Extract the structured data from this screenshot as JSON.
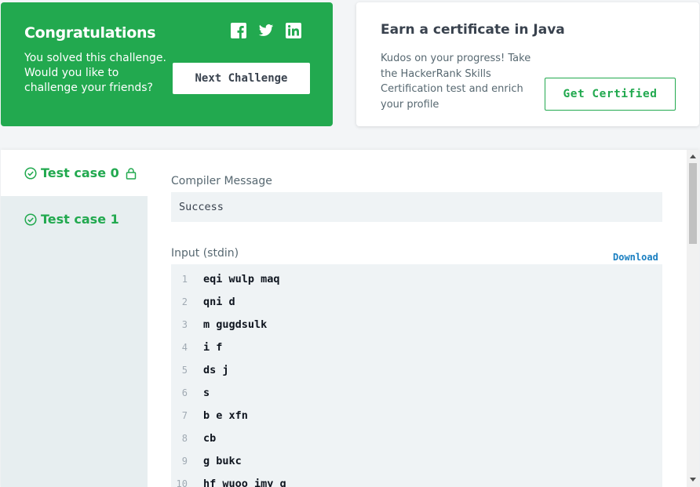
{
  "congrats": {
    "title": "Congratulations",
    "message": "You solved this challenge. Would you like to challenge your friends?",
    "next_button": "Next Challenge",
    "social_icons": [
      "facebook-icon",
      "twitter-icon",
      "linkedin-icon"
    ]
  },
  "certificate": {
    "title": "Earn a certificate in Java",
    "message": "Kudos on your progress! Take the HackerRank Skills Certification test and enrich your profile",
    "button": "Get Certified"
  },
  "tabs": [
    {
      "label": "Test case 0",
      "status": "passed",
      "locked": true,
      "active": true
    },
    {
      "label": "Test case 1",
      "status": "passed",
      "locked": false,
      "active": false
    }
  ],
  "compiler": {
    "label": "Compiler Message",
    "message": "Success"
  },
  "input": {
    "label": "Input (stdin)",
    "download": "Download",
    "lines": [
      {
        "num": "1",
        "text": "eqi wulp maq"
      },
      {
        "num": "2",
        "text": "qni d"
      },
      {
        "num": "3",
        "text": "m gugdsulk"
      },
      {
        "num": "4",
        "text": "i f"
      },
      {
        "num": "5",
        "text": "ds j"
      },
      {
        "num": "6",
        "text": "s"
      },
      {
        "num": "7",
        "text": "b e xfn"
      },
      {
        "num": "8",
        "text": "cb"
      },
      {
        "num": "9",
        "text": "g bukc"
      },
      {
        "num": "10",
        "text": "hf wuoo imy g"
      }
    ]
  },
  "colors": {
    "success_green": "#22a94f",
    "link_blue": "#1a7fc1",
    "text_dark": "#39424e"
  }
}
